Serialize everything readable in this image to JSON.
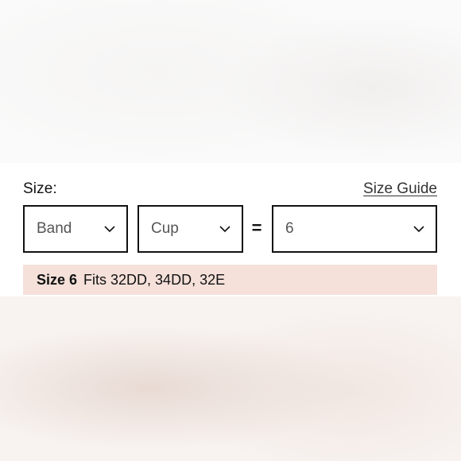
{
  "size_selector": {
    "label": "Size:",
    "guide_link": "Size Guide",
    "band": {
      "value": "Band"
    },
    "cup": {
      "value": "Cup"
    },
    "equals": "=",
    "size": {
      "value": "6"
    },
    "fit": {
      "size_name": "Size 6",
      "description": "Fits 32DD, 34DD, 32E"
    }
  },
  "colors": {
    "banner": "#f5e1da",
    "border": "#111111"
  },
  "icons": {
    "dropdown": "chevron-down-icon"
  }
}
